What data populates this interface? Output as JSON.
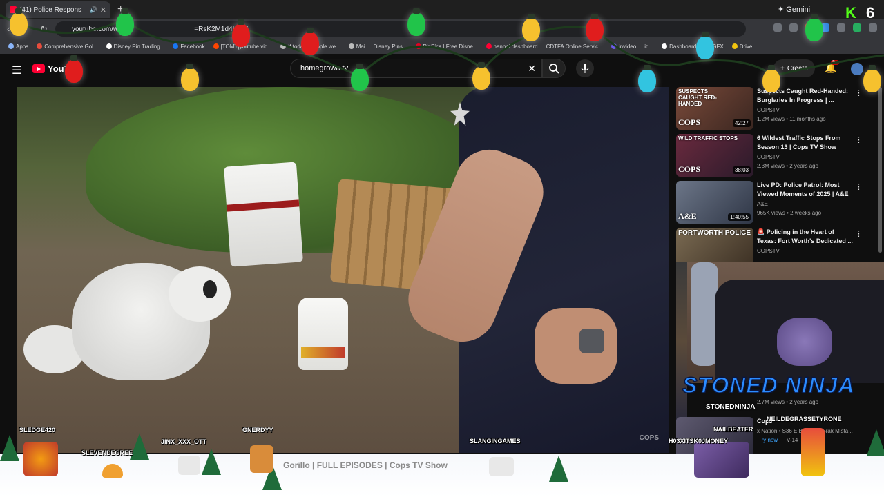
{
  "browser": {
    "tab_title": "(41) Police Respons",
    "url": "youtube.com/w",
    "url_tail": "=RsK2M1d4URM",
    "gemini_label": "Gemini",
    "bookmarks": [
      "Apps",
      "Comprehensive Gol...",
      "Disney Pin Trading...",
      "Facebook",
      "[TOMT]youtube vid...",
      "If todays people we...",
      "Mai",
      "Disney Pins...",
      "PinPics | Free Disne...",
      "hannel dashboard",
      "CDTFA Online Servic...",
      "invideo",
      "id...",
      "Dashboard",
      "GFX",
      "Drive"
    ]
  },
  "youtube": {
    "logo_text": "YouT",
    "search_value": "homegrown tv",
    "create_label": "Create",
    "notif_count": "9+"
  },
  "video": {
    "watermark": "COPS"
  },
  "sidebar": {
    "items": [
      {
        "thumb_top": "SUSPECTS CAUGHT RED-HANDED",
        "thumb_bottom": "COPS",
        "duration": "42:27",
        "title": "Suspects Caught Red-Handed: Burglaries In Progress | ...",
        "channel": "COPSTV",
        "meta": "1.2M views • 11 months ago",
        "color": "#5b3a32"
      },
      {
        "thumb_top": "WILD TRAFFIC STOPS",
        "thumb_bottom": "COPS",
        "duration": "38:03",
        "title": "6 Wildest Traffic Stops From Season 13 | Cops TV Show",
        "channel": "COPSTV",
        "meta": "2.3M views • 2 years ago",
        "color": "#3f2a3e"
      },
      {
        "thumb_top": "",
        "thumb_bottom": "A&E",
        "duration": "1:40:55",
        "title": "Live PD: Police Patrol: Most Viewed Moments of 2025 | A&E",
        "channel": "A&E",
        "meta": "965K views • 2 weeks ago",
        "color": "#4c5566"
      },
      {
        "thumb_top": "FORTWORTH POLICE",
        "thumb_bottom": "",
        "duration": "",
        "title": "🚨 Policing in the Heart of Texas: Fort Worth's Dedicated ...",
        "channel": "COPSTV",
        "meta": "",
        "color": "#5e4f3e"
      }
    ]
  },
  "stream_overlay": {
    "brand_text": "STONED NINJA",
    "brand_user": "STONEDNINJA",
    "kick_label": "K",
    "kick_count": "6",
    "usernames": [
      "SLEDGE420",
      "SLEVENDEGREE",
      "JINX_XXX_OTT",
      "GNERDYY",
      "SLANGINGAMES",
      "NAILBEATER",
      "NEILDEGRASSETYRONE",
      "H03XITSK0JMONEY"
    ],
    "bottom_title": "Gorillo | FULL EPISODES | Cops TV Show",
    "side_partial_title": "Cops",
    "side_partial_meta": "x Nation • S36 E Breaking Brak Mista...",
    "side_partial_views": "2.7M views • 2 years ago",
    "side_partial_badge": "Try now",
    "side_partial_rating": "TV-14"
  },
  "colors": {
    "bulbs": [
      "#f6c12e",
      "#21c44a",
      "#e01d1d",
      "#f6c12e",
      "#32c4e0"
    ]
  }
}
